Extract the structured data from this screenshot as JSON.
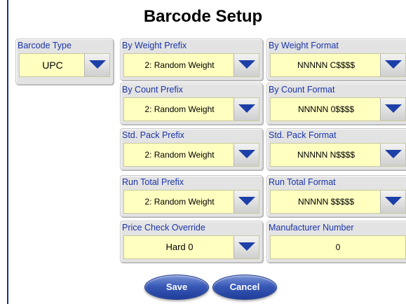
{
  "title": "Barcode Setup",
  "barcode_type": {
    "label": "Barcode Type",
    "value": "UPC"
  },
  "rows": [
    {
      "left_label": "By Weight Prefix",
      "left_value": "2: Random Weight",
      "right_label": "By Weight Format",
      "right_value": "NNNNN C$$$$"
    },
    {
      "left_label": "By Count Prefix",
      "left_value": "2: Random Weight",
      "right_label": "By Count Format",
      "right_value": "NNNNN 0$$$$"
    },
    {
      "left_label": "Std. Pack Prefix",
      "left_value": "2: Random Weight",
      "right_label": "Std. Pack Format",
      "right_value": "NNNNN N$$$$"
    },
    {
      "left_label": "Run Total Prefix",
      "left_value": "2: Random Weight",
      "right_label": "Run Total Format",
      "right_value": "NNNNN $$$$$"
    }
  ],
  "price_check": {
    "label": "Price Check Override",
    "value": "Hard 0"
  },
  "manufacturer": {
    "label": "Manufacturer Number",
    "value": "0"
  },
  "buttons": {
    "save": "Save",
    "cancel": "Cancel"
  },
  "colors": {
    "label_blue": "#1a34a8",
    "field_yellow": "#ffffc0",
    "arrow_blue": "#1d3fa8",
    "button_blue": "#3a5ab8"
  },
  "icons": {
    "dropdown": "chevron-down-icon"
  }
}
